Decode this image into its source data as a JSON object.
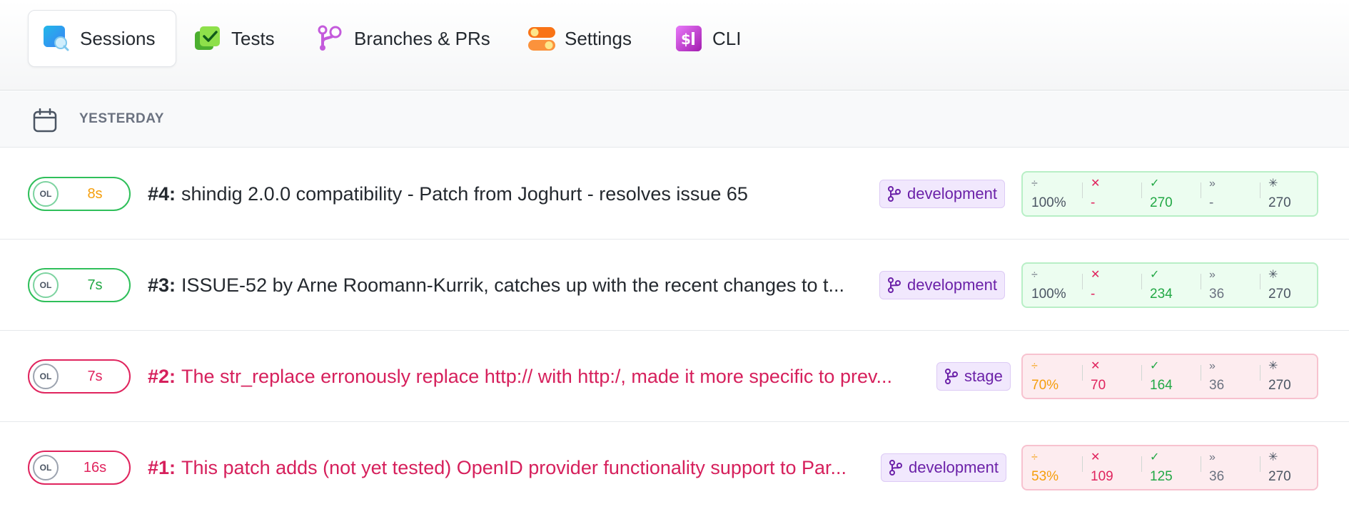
{
  "nav": {
    "tabs": [
      {
        "label": "Sessions"
      },
      {
        "label": "Tests"
      },
      {
        "label": "Branches & PRs"
      },
      {
        "label": "Settings"
      },
      {
        "label": "CLI"
      }
    ]
  },
  "section": {
    "label": "YESTERDAY"
  },
  "rows": [
    {
      "initials": "OL",
      "duration": "8s",
      "num": "#4:",
      "title": "shindig 2.0.0 compatibility - Patch from Joghurt - resolves issue 65",
      "branch": "development",
      "stats": {
        "ratio": "100%",
        "failed": "-",
        "passed": "270",
        "skipped": "-",
        "total": "270"
      }
    },
    {
      "initials": "OL",
      "duration": "7s",
      "num": "#3:",
      "title": "ISSUE-52 by Arne Roomann-Kurrik, catches up with the recent changes to t...",
      "branch": "development",
      "stats": {
        "ratio": "100%",
        "failed": "-",
        "passed": "234",
        "skipped": "36",
        "total": "270"
      }
    },
    {
      "initials": "OL",
      "duration": "7s",
      "num": "#2:",
      "title": "The str_replace erronously replace http:// with http:/, made it more specific to prev...",
      "branch": "stage",
      "stats": {
        "ratio": "70%",
        "failed": "70",
        "passed": "164",
        "skipped": "36",
        "total": "270"
      }
    },
    {
      "initials": "OL",
      "duration": "16s",
      "num": "#1:",
      "title": "This patch adds (not yet tested) OpenID provider functionality support to Par...",
      "branch": "development",
      "stats": {
        "ratio": "53%",
        "failed": "109",
        "passed": "125",
        "skipped": "36",
        "total": "270"
      }
    }
  ],
  "colors": {
    "pass": "#2fbf5a",
    "fail": "#e0245e",
    "warning": "#f59e0b",
    "branch_bg": "#f1e8fd"
  }
}
